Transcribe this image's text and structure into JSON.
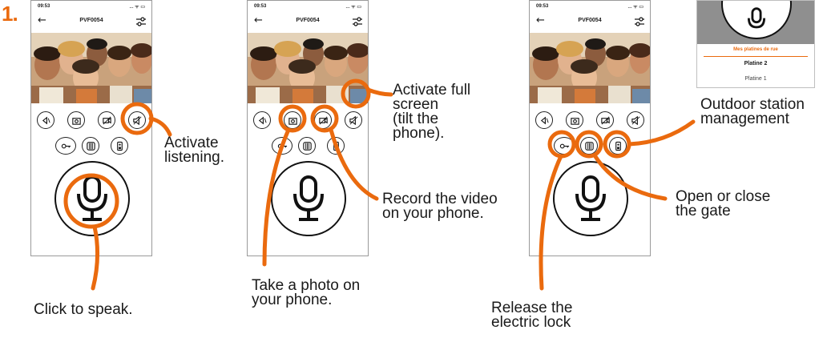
{
  "step_number": "1.",
  "phone": {
    "time": "09:53",
    "status_icons": "... ᯤ ▭",
    "back_label": "←",
    "title": "PVF0054"
  },
  "panel": {
    "header": "Mes platines de rue",
    "item_selected": "Platine 2",
    "item_other": "Platine 1"
  },
  "captions": {
    "listening": "Activate\nlistening.",
    "speak": "Click to speak.",
    "fullscreen": "Activate full\nscreen\n(tilt the\nphone).",
    "record": "Record the video\non your phone.",
    "photo": "Take a photo on\nyour phone.",
    "station": "Outdoor station\nmanagement",
    "gate": "Open or close\nthe gate",
    "lock": "Release the\nelectric lock"
  },
  "colors": {
    "accent": "#ea6a0e",
    "outline": "#111111"
  }
}
